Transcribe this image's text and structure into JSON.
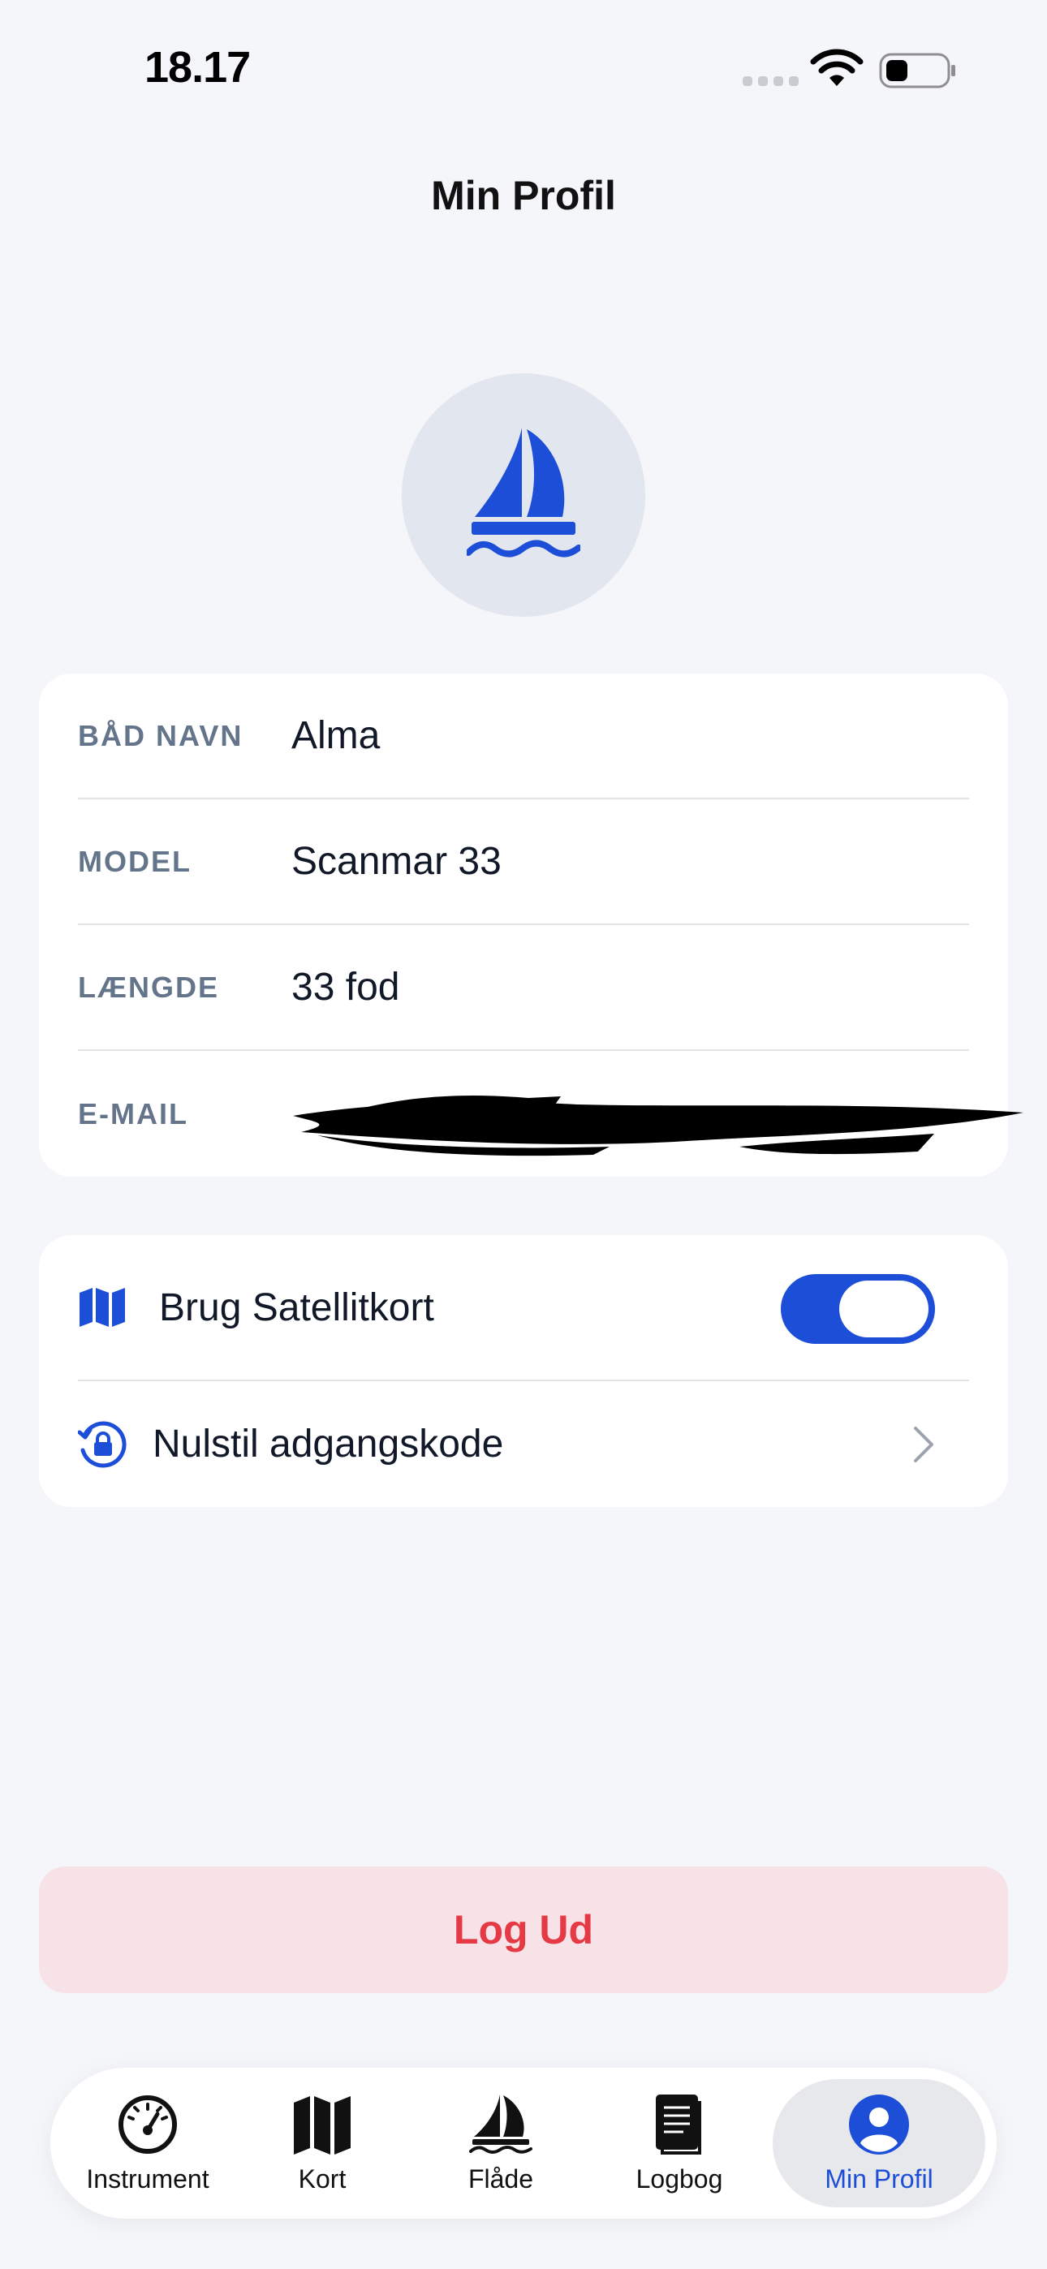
{
  "status_bar": {
    "time": "18.17",
    "wifi_icon": "wifi-icon",
    "battery_icon": "battery-icon"
  },
  "page_title": "Min Profil",
  "avatar_icon": "sailboat-icon",
  "boat_info": {
    "rows": [
      {
        "label": "BÅD NAVN",
        "value": "Alma"
      },
      {
        "label": "MODEL",
        "value": "Scanmar 33"
      },
      {
        "label": "LÆNGDE",
        "value": "33 fod"
      },
      {
        "label": "E-MAIL",
        "value": ""
      }
    ]
  },
  "settings": {
    "satellite": {
      "label": "Brug Satellitkort",
      "icon": "map-icon",
      "enabled": true
    },
    "reset_password": {
      "label": "Nulstil adgangskode",
      "icon": "lock-rotation-icon"
    }
  },
  "logout_label": "Log Ud",
  "tabs": [
    {
      "label": "Instrument",
      "icon": "gauge-icon",
      "active": false
    },
    {
      "label": "Kort",
      "icon": "map-icon",
      "active": false
    },
    {
      "label": "Flåde",
      "icon": "sailboat-icon",
      "active": false
    },
    {
      "label": "Logbog",
      "icon": "logbook-icon",
      "active": false
    },
    {
      "label": "Min Profil",
      "icon": "person-circle-icon",
      "active": true
    }
  ],
  "colors": {
    "accent": "#1d4ed8",
    "danger": "#e53945",
    "danger_bg": "#f7e3e7",
    "background": "#f5f6fa"
  }
}
